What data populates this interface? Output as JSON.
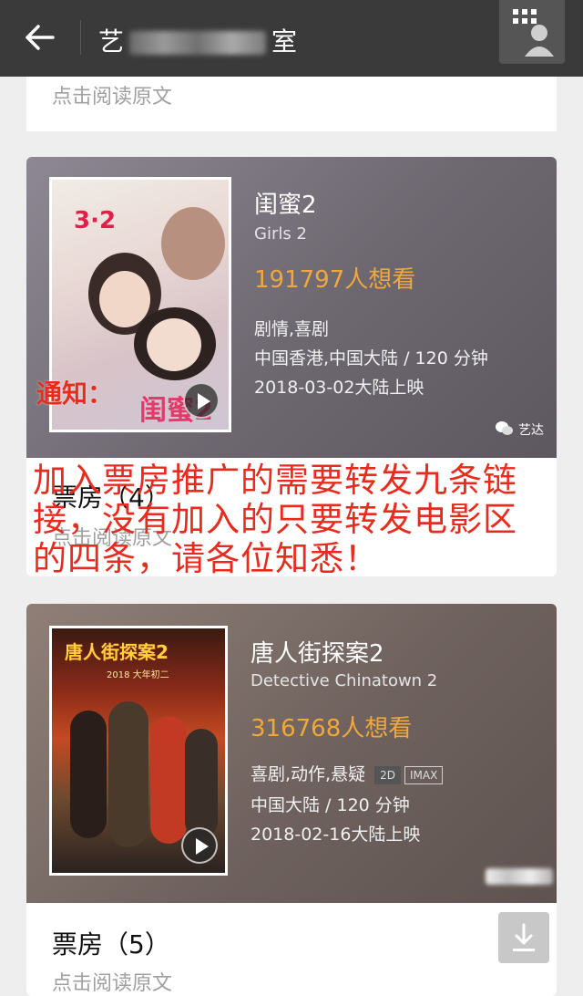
{
  "header": {
    "title_start": "艺",
    "title_end": "室"
  },
  "read_original": "点击阅读原文",
  "movies": [
    {
      "title": "闺蜜2",
      "title_en": "Girls 2",
      "want": "191797人想看",
      "genre": "剧情,喜剧",
      "region_duration": "中国香港,中国大陆 / 120 分钟",
      "release": "2018-03-02大陆上映",
      "poster_date": "3·2",
      "poster_title": "闺蜜2",
      "watermark": "艺达",
      "box_office": "票房（4）"
    },
    {
      "title": "唐人街探案2",
      "title_en": "Detective Chinatown 2",
      "want": "316768人想看",
      "genre": "喜剧,动作,悬疑",
      "tags": [
        "2D",
        "IMAX"
      ],
      "region_duration": "中国大陆 / 120 分钟",
      "release": "2018-02-16大陆上映",
      "poster_title": "唐人街探案2",
      "poster_sub": "2018 大年初二",
      "box_office": "票房（5）"
    }
  ],
  "notice": {
    "heading": "通知：",
    "body": "加入票房推广的需要转发九条链接，没有加入的只要转发电影区的四条，请各位知悉！"
  },
  "colors": {
    "topbar": "#3a3a3a",
    "want_count": "#f0a83a",
    "notice_red": "#ea2a1c"
  },
  "icons": [
    "back-arrow-icon",
    "user-icon",
    "play-icon",
    "wechat-icon",
    "download-icon"
  ]
}
